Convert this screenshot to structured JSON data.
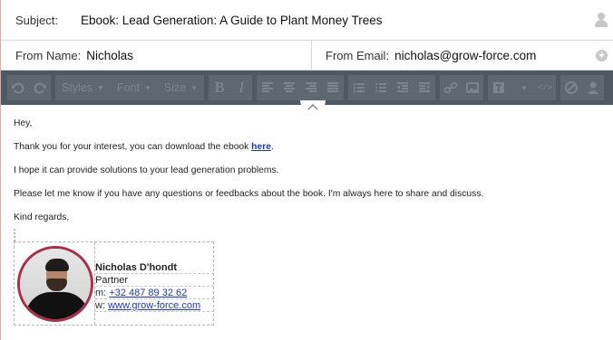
{
  "subject": {
    "label": "Subject:",
    "value": "Ebook: Lead Generation: A Guide to Plant Money Trees"
  },
  "from_name": {
    "label": "From Name:",
    "value": "Nicholas"
  },
  "from_email": {
    "label": "From Email:",
    "value": "nicholas@grow-force.com"
  },
  "toolbar": {
    "styles_label": "Styles",
    "font_label": "Font",
    "size_label": "Size",
    "bold_label": "B",
    "italic_label": "I",
    "code_label": "</>"
  },
  "body": {
    "greeting": "Hey,",
    "line1_prefix": "Thank you for your interest, you can download the ebook ",
    "line1_link": "here",
    "line1_suffix": ".",
    "line2": "I hope it can provide solutions to your lead generation problems.",
    "line3": "Please let me know if you have any questions or feedbacks about the book. I'm always here to share and discuss.",
    "closing": "Kind regards,"
  },
  "signature": {
    "name": "Nicholas D'hondt",
    "title": "Partner",
    "phone_key": "m:",
    "phone": "+32 487 89 32 62",
    "web_key": "w:",
    "website": "www.grow-force.com",
    "accent_color": "#a8304b"
  },
  "colors": {
    "toolbar_bg": "#4f5962",
    "link": "#1e3aa8"
  }
}
